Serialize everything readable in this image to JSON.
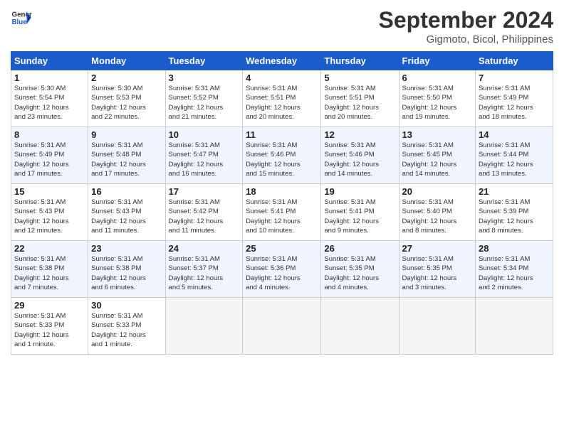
{
  "header": {
    "logo_line1": "General",
    "logo_line2": "Blue",
    "month_title": "September 2024",
    "location": "Gigmoto, Bicol, Philippines"
  },
  "weekdays": [
    "Sunday",
    "Monday",
    "Tuesday",
    "Wednesday",
    "Thursday",
    "Friday",
    "Saturday"
  ],
  "weeks": [
    [
      {
        "day": "1",
        "info": "Sunrise: 5:30 AM\nSunset: 5:54 PM\nDaylight: 12 hours\nand 23 minutes."
      },
      {
        "day": "2",
        "info": "Sunrise: 5:30 AM\nSunset: 5:53 PM\nDaylight: 12 hours\nand 22 minutes."
      },
      {
        "day": "3",
        "info": "Sunrise: 5:31 AM\nSunset: 5:52 PM\nDaylight: 12 hours\nand 21 minutes."
      },
      {
        "day": "4",
        "info": "Sunrise: 5:31 AM\nSunset: 5:51 PM\nDaylight: 12 hours\nand 20 minutes."
      },
      {
        "day": "5",
        "info": "Sunrise: 5:31 AM\nSunset: 5:51 PM\nDaylight: 12 hours\nand 20 minutes."
      },
      {
        "day": "6",
        "info": "Sunrise: 5:31 AM\nSunset: 5:50 PM\nDaylight: 12 hours\nand 19 minutes."
      },
      {
        "day": "7",
        "info": "Sunrise: 5:31 AM\nSunset: 5:49 PM\nDaylight: 12 hours\nand 18 minutes."
      }
    ],
    [
      {
        "day": "8",
        "info": "Sunrise: 5:31 AM\nSunset: 5:49 PM\nDaylight: 12 hours\nand 17 minutes."
      },
      {
        "day": "9",
        "info": "Sunrise: 5:31 AM\nSunset: 5:48 PM\nDaylight: 12 hours\nand 17 minutes."
      },
      {
        "day": "10",
        "info": "Sunrise: 5:31 AM\nSunset: 5:47 PM\nDaylight: 12 hours\nand 16 minutes."
      },
      {
        "day": "11",
        "info": "Sunrise: 5:31 AM\nSunset: 5:46 PM\nDaylight: 12 hours\nand 15 minutes."
      },
      {
        "day": "12",
        "info": "Sunrise: 5:31 AM\nSunset: 5:46 PM\nDaylight: 12 hours\nand 14 minutes."
      },
      {
        "day": "13",
        "info": "Sunrise: 5:31 AM\nSunset: 5:45 PM\nDaylight: 12 hours\nand 14 minutes."
      },
      {
        "day": "14",
        "info": "Sunrise: 5:31 AM\nSunset: 5:44 PM\nDaylight: 12 hours\nand 13 minutes."
      }
    ],
    [
      {
        "day": "15",
        "info": "Sunrise: 5:31 AM\nSunset: 5:43 PM\nDaylight: 12 hours\nand 12 minutes."
      },
      {
        "day": "16",
        "info": "Sunrise: 5:31 AM\nSunset: 5:43 PM\nDaylight: 12 hours\nand 11 minutes."
      },
      {
        "day": "17",
        "info": "Sunrise: 5:31 AM\nSunset: 5:42 PM\nDaylight: 12 hours\nand 11 minutes."
      },
      {
        "day": "18",
        "info": "Sunrise: 5:31 AM\nSunset: 5:41 PM\nDaylight: 12 hours\nand 10 minutes."
      },
      {
        "day": "19",
        "info": "Sunrise: 5:31 AM\nSunset: 5:41 PM\nDaylight: 12 hours\nand 9 minutes."
      },
      {
        "day": "20",
        "info": "Sunrise: 5:31 AM\nSunset: 5:40 PM\nDaylight: 12 hours\nand 8 minutes."
      },
      {
        "day": "21",
        "info": "Sunrise: 5:31 AM\nSunset: 5:39 PM\nDaylight: 12 hours\nand 8 minutes."
      }
    ],
    [
      {
        "day": "22",
        "info": "Sunrise: 5:31 AM\nSunset: 5:38 PM\nDaylight: 12 hours\nand 7 minutes."
      },
      {
        "day": "23",
        "info": "Sunrise: 5:31 AM\nSunset: 5:38 PM\nDaylight: 12 hours\nand 6 minutes."
      },
      {
        "day": "24",
        "info": "Sunrise: 5:31 AM\nSunset: 5:37 PM\nDaylight: 12 hours\nand 5 minutes."
      },
      {
        "day": "25",
        "info": "Sunrise: 5:31 AM\nSunset: 5:36 PM\nDaylight: 12 hours\nand 4 minutes."
      },
      {
        "day": "26",
        "info": "Sunrise: 5:31 AM\nSunset: 5:35 PM\nDaylight: 12 hours\nand 4 minutes."
      },
      {
        "day": "27",
        "info": "Sunrise: 5:31 AM\nSunset: 5:35 PM\nDaylight: 12 hours\nand 3 minutes."
      },
      {
        "day": "28",
        "info": "Sunrise: 5:31 AM\nSunset: 5:34 PM\nDaylight: 12 hours\nand 2 minutes."
      }
    ],
    [
      {
        "day": "29",
        "info": "Sunrise: 5:31 AM\nSunset: 5:33 PM\nDaylight: 12 hours\nand 1 minute."
      },
      {
        "day": "30",
        "info": "Sunrise: 5:31 AM\nSunset: 5:33 PM\nDaylight: 12 hours\nand 1 minute."
      },
      null,
      null,
      null,
      null,
      null
    ]
  ]
}
